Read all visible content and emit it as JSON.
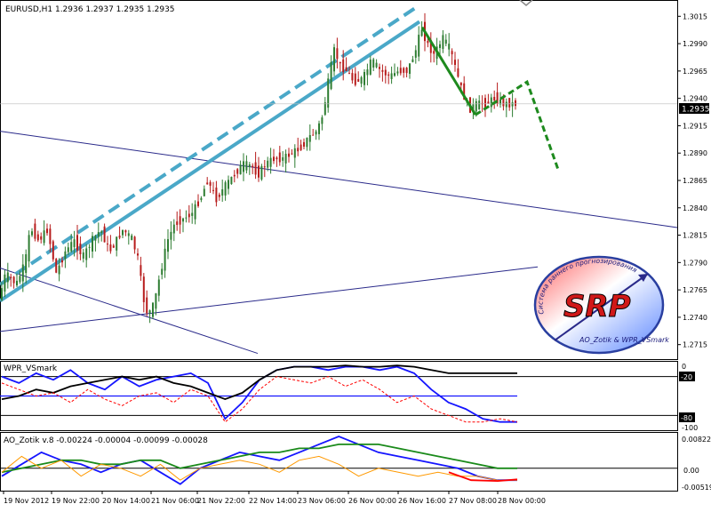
{
  "main": {
    "header": "EURUSD,H1  1.2936 1.2937 1.2935 1.2935",
    "current_price": "1.2935"
  },
  "wpr": {
    "header": "WPR_VSmark",
    "ticks": [
      "0",
      "-20",
      "-80",
      "-100"
    ],
    "level_labels": [
      "-20",
      "-80"
    ]
  },
  "ao": {
    "header": "AO_Zotik v.8 -0.00224 -0.00004 -0.00099 -0.00028",
    "ticks": [
      "0.00822",
      "0.00",
      "-0.00519"
    ]
  },
  "logo": {
    "letters": "SRP",
    "arc_text": "Система раннего прогнозирования",
    "bottom_text": "AO_Zotik & WPR_VSmark"
  },
  "colors": {
    "up_candle": "#2e7d32",
    "down_candle": "#b71c1c",
    "channel": "#4aa8c8",
    "projection": "#1e8a1e",
    "trendline": "#2a2a8a",
    "wpr_blue": "#1515ff",
    "wpr_black": "#000000",
    "wpr_red": "#ff0000",
    "ao_blue": "#1515ff",
    "ao_green": "#1a8a1a",
    "ao_orange": "#ff9900",
    "ao_red": "#ff0000",
    "ao_black": "#000000"
  },
  "chart_data": [
    {
      "type": "candlestick",
      "title": "EURUSD,H1  1.2936 1.2937 1.2935 1.2935",
      "x_ticks": [
        "19 Nov 2012",
        "19 Nov 22:00",
        "20 Nov 14:00",
        "21 Nov 06:00",
        "21 Nov 22:00",
        "22 Nov 14:00",
        "23 Nov 06:00",
        "26 Nov 00:00",
        "26 Nov 16:00",
        "27 Nov 08:00",
        "28 Nov 00:00"
      ],
      "y_ticks": [
        "1.3015",
        "1.2990",
        "1.2965",
        "1.2940",
        "1.2915",
        "1.2890",
        "1.2865",
        "1.2840",
        "1.2815",
        "1.2790",
        "1.2765",
        "1.2740",
        "1.2715"
      ],
      "ylim": [
        1.2705,
        1.3025
      ],
      "price_path": [
        [
          0,
          1.2755
        ],
        [
          8,
          1.278
        ],
        [
          20,
          1.277
        ],
        [
          30,
          1.279
        ],
        [
          36,
          1.2822
        ],
        [
          45,
          1.281
        ],
        [
          55,
          1.282
        ],
        [
          65,
          1.278
        ],
        [
          75,
          1.28
        ],
        [
          85,
          1.281
        ],
        [
          95,
          1.2795
        ],
        [
          105,
          1.281
        ],
        [
          115,
          1.282
        ],
        [
          125,
          1.28
        ],
        [
          140,
          1.282
        ],
        [
          150,
          1.2812
        ],
        [
          158,
          1.279
        ],
        [
          162,
          1.276
        ],
        [
          168,
          1.2742
        ],
        [
          175,
          1.2752
        ],
        [
          182,
          1.278
        ],
        [
          190,
          1.281
        ],
        [
          198,
          1.2825
        ],
        [
          208,
          1.283
        ],
        [
          218,
          1.2835
        ],
        [
          228,
          1.285
        ],
        [
          235,
          1.2865
        ],
        [
          245,
          1.2848
        ],
        [
          255,
          1.286
        ],
        [
          265,
          1.287
        ],
        [
          275,
          1.288
        ],
        [
          285,
          1.2878
        ],
        [
          292,
          1.287
        ],
        [
          300,
          1.288
        ],
        [
          310,
          1.2885
        ],
        [
          320,
          1.2885
        ],
        [
          330,
          1.289
        ],
        [
          340,
          1.2895
        ],
        [
          350,
          1.2905
        ],
        [
          358,
          1.291
        ],
        [
          365,
          1.2925
        ],
        [
          372,
          1.296
        ],
        [
          378,
          1.2985
        ],
        [
          384,
          1.297
        ],
        [
          392,
          1.2965
        ],
        [
          400,
          1.2955
        ],
        [
          410,
          1.2958
        ],
        [
          420,
          1.2975
        ],
        [
          430,
          1.2965
        ],
        [
          440,
          1.296
        ],
        [
          450,
          1.2965
        ],
        [
          460,
          1.2965
        ],
        [
          470,
          1.2985
        ],
        [
          476,
          1.3005
        ],
        [
          482,
          1.299
        ],
        [
          490,
          1.298
        ],
        [
          500,
          1.2995
        ],
        [
          508,
          1.2985
        ],
        [
          515,
          1.2965
        ],
        [
          522,
          1.2945
        ],
        [
          530,
          1.293
        ],
        [
          538,
          1.2935
        ],
        [
          548,
          1.2935
        ],
        [
          558,
          1.294
        ],
        [
          568,
          1.2935
        ],
        [
          578,
          1.2935
        ]
      ],
      "channel_lower": [
        [
          1.2765,
          "19 Nov 2012"
        ],
        [
          1.301,
          "26 Nov 16:00"
        ]
      ],
      "projection": [
        1.2925,
        1.2955,
        1.2875
      ],
      "note_lines": "long-term trendlines descending and ascending, green zigzag forecast"
    },
    {
      "type": "line",
      "title": "WPR_VSmark",
      "ylim": [
        -100,
        0
      ],
      "levels": [
        -20,
        -80
      ],
      "series": [
        {
          "values": [
            -20,
            -30,
            -15,
            -25,
            -10,
            -30,
            -40,
            -20,
            -35,
            -25,
            -20,
            -15,
            -30,
            -85,
            -60,
            -25,
            -10,
            -5,
            -5,
            -10,
            -5,
            -5,
            -10,
            -5,
            -15,
            -40,
            -60,
            -70,
            -85,
            -90,
            -90
          ]
        },
        {
          "values": [
            -55,
            -50,
            -40,
            -45,
            -35,
            -30,
            -25,
            -20,
            -25,
            -20,
            -30,
            -35,
            -45,
            -55,
            -45,
            -25,
            -10,
            -5,
            -5,
            -5,
            -3,
            -5,
            -5,
            -3,
            -5,
            -10,
            -15,
            -15,
            -15,
            -15,
            -15
          ]
        },
        {
          "values": [
            -30,
            -40,
            -50,
            -45,
            -60,
            -40,
            -55,
            -65,
            -50,
            -45,
            -60,
            -40,
            -50,
            -90,
            -70,
            -40,
            -20,
            -25,
            -30,
            -20,
            -35,
            -25,
            -40,
            -60,
            -50,
            -70,
            -80,
            -90,
            -90,
            -85,
            -90
          ]
        }
      ]
    },
    {
      "type": "line",
      "title": "AO_Zotik v.8 -0.00224 -0.00004 -0.00099 -0.00028",
      "ylim": [
        -0.00519,
        0.00822
      ],
      "series": [
        {
          "values": [
            -0.002,
            0.001,
            0.004,
            0.002,
            0.001,
            -0.001,
            0.001,
            0.002,
            -0.001,
            -0.004,
            0.0,
            0.002,
            0.004,
            0.003,
            0.002,
            0.004,
            0.006,
            0.008,
            0.006,
            0.004,
            0.003,
            0.002,
            0.001,
            0.0,
            -0.002,
            -0.003,
            -0.003
          ]
        },
        {
          "values": [
            -0.001,
            0.0,
            0.001,
            0.002,
            0.002,
            0.001,
            0.001,
            0.002,
            0.002,
            0.0,
            0.001,
            0.002,
            0.003,
            0.004,
            0.004,
            0.005,
            0.005,
            0.006,
            0.006,
            0.006,
            0.005,
            0.004,
            0.003,
            0.002,
            0.001,
            0.0,
            0.0
          ]
        },
        {
          "values": [
            -0.001,
            0.003,
            0.0,
            0.002,
            -0.002,
            0.001,
            0.0,
            -0.002,
            0.001,
            -0.003,
            0.0,
            0.001,
            0.002,
            0.001,
            -0.001,
            0.002,
            0.003,
            0.001,
            -0.002,
            0.0,
            -0.001,
            -0.002,
            -0.001,
            -0.002,
            -0.002,
            -0.003,
            -0.003
          ]
        }
      ]
    }
  ]
}
